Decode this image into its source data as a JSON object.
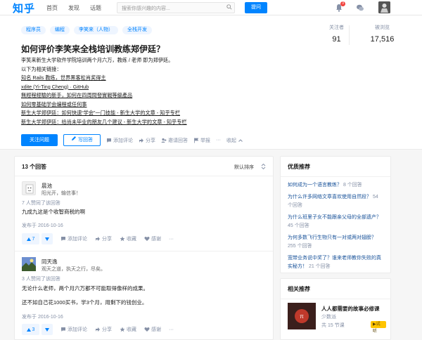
{
  "topbar": {
    "logo": "知乎",
    "nav": [
      "首页",
      "发现",
      "话题"
    ],
    "search_placeholder": "搜索你感兴趣的内容...",
    "ask_label": "提问",
    "notification_count": "3"
  },
  "question": {
    "tags": [
      "程序员",
      "编程",
      "李笑来（人物）",
      "全栈开发"
    ],
    "title": "如何评价李笑来全栈培训教练郑伊廷？",
    "detail": [
      {
        "text": "李笑来新生大学软件学院培训两个月六万，教练 / 老师 即为郑伊廷。",
        "link": false
      },
      {
        "text": "以下为相关链接：",
        "link": false
      },
      {
        "text": "知名 Rails 教练，世界黑客松肖奖得主",
        "link": true
      },
      {
        "text": "xdite (Yi-Ting Cheng) · GitHub",
        "link": true
      },
      {
        "text": "無經程經驗的新手，如何在四周間發實戰等級產品",
        "link": true
      },
      {
        "text": "如何零基础学会编程或任何事",
        "link": true
      },
      {
        "text": "新生大学郑伊廷：如何快速“学会”一门技能 - 新生大学的文章 - 知乎专栏",
        "link": true
      },
      {
        "text": "新生大学郑伊廷：给尚未毕业的朋友几个建议 - 新生大学的文章 - 知乎专栏",
        "link": true
      }
    ],
    "stats": {
      "followers_label": "关注者",
      "followers": "91",
      "views_label": "被浏览",
      "views": "17,516"
    },
    "actions": {
      "follow": "关注问题",
      "answer": "写回答",
      "comment": "添加评论",
      "share": "分享",
      "invite": "邀请回答",
      "report": "举报",
      "more": "收起"
    }
  },
  "answers": {
    "count_label": "13 个回答",
    "sort_label": "默认排序",
    "items": [
      {
        "name": "晨池",
        "bio": "阳光开，输信事！",
        "votes": "7 人赞同了该回答",
        "text": [
          "九成九这是个收智商税的啊"
        ],
        "date": "发布于 2016-10-16",
        "upvote": "7",
        "comment": "添加评论",
        "share": "分享",
        "collect": "收藏",
        "thanks": "感谢"
      },
      {
        "name": "同天逸",
        "bio": "观天之道，执天之行，尽矣。",
        "votes": "3 人赞同了该回答",
        "text": [
          "无论什么老师，两个月六万都不可能取得像样的成果。",
          "还不如自己花1000买书，学3个月，用剩下的钱创业。"
        ],
        "date": "发布于 2016-10-16",
        "upvote": "3",
        "comment": "添加评论",
        "share": "分享",
        "collect": "收藏",
        "thanks": "感谢"
      }
    ]
  },
  "sidebar": {
    "recommend_title": "优质推荐",
    "recommend": [
      {
        "title": "如何成为一个语言教练？",
        "count": "8 个回答"
      },
      {
        "title": "为什么许多网络文章喜欢使用自然段？",
        "count": "54 个回答"
      },
      {
        "title": "为什么班里子女不能跟亲父母的全部遗产？",
        "count": "45 个回答"
      },
      {
        "title": "为何多数飞行生物只有一对或两对翅膀？",
        "count": "255 个回答"
      },
      {
        "title": "宽带业务说中奖了？谁来老师教你失败的真实秘方！",
        "count": "21 个回答"
      }
    ],
    "related_title": "相关推荐",
    "live": {
      "title": "人人都需要的故事必修课",
      "author": "少数派",
      "meta": "共 15 节课",
      "badge": "▶试听"
    }
  }
}
